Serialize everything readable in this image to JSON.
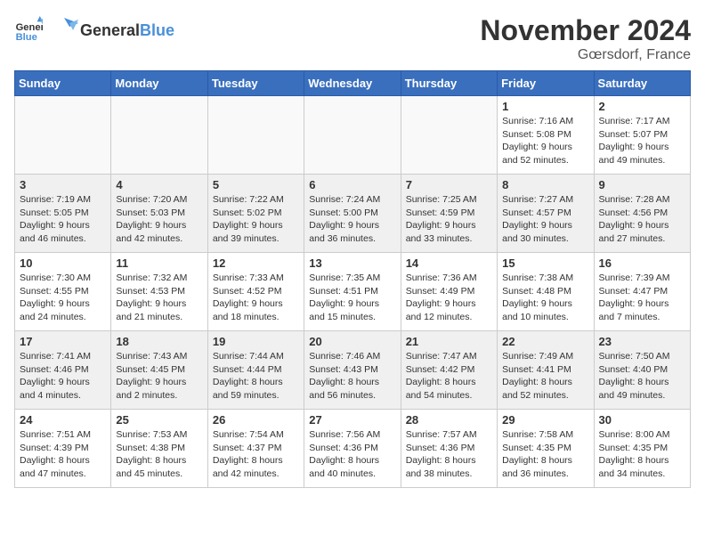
{
  "header": {
    "logo_general": "General",
    "logo_blue": "Blue",
    "month_year": "November 2024",
    "location": "Gœrsdorf, France"
  },
  "days_of_week": [
    "Sunday",
    "Monday",
    "Tuesday",
    "Wednesday",
    "Thursday",
    "Friday",
    "Saturday"
  ],
  "weeks": [
    {
      "shaded": false,
      "days": [
        {
          "date": "",
          "info": ""
        },
        {
          "date": "",
          "info": ""
        },
        {
          "date": "",
          "info": ""
        },
        {
          "date": "",
          "info": ""
        },
        {
          "date": "",
          "info": ""
        },
        {
          "date": "1",
          "info": "Sunrise: 7:16 AM\nSunset: 5:08 PM\nDaylight: 9 hours and 52 minutes."
        },
        {
          "date": "2",
          "info": "Sunrise: 7:17 AM\nSunset: 5:07 PM\nDaylight: 9 hours and 49 minutes."
        }
      ]
    },
    {
      "shaded": true,
      "days": [
        {
          "date": "3",
          "info": "Sunrise: 7:19 AM\nSunset: 5:05 PM\nDaylight: 9 hours and 46 minutes."
        },
        {
          "date": "4",
          "info": "Sunrise: 7:20 AM\nSunset: 5:03 PM\nDaylight: 9 hours and 42 minutes."
        },
        {
          "date": "5",
          "info": "Sunrise: 7:22 AM\nSunset: 5:02 PM\nDaylight: 9 hours and 39 minutes."
        },
        {
          "date": "6",
          "info": "Sunrise: 7:24 AM\nSunset: 5:00 PM\nDaylight: 9 hours and 36 minutes."
        },
        {
          "date": "7",
          "info": "Sunrise: 7:25 AM\nSunset: 4:59 PM\nDaylight: 9 hours and 33 minutes."
        },
        {
          "date": "8",
          "info": "Sunrise: 7:27 AM\nSunset: 4:57 PM\nDaylight: 9 hours and 30 minutes."
        },
        {
          "date": "9",
          "info": "Sunrise: 7:28 AM\nSunset: 4:56 PM\nDaylight: 9 hours and 27 minutes."
        }
      ]
    },
    {
      "shaded": false,
      "days": [
        {
          "date": "10",
          "info": "Sunrise: 7:30 AM\nSunset: 4:55 PM\nDaylight: 9 hours and 24 minutes."
        },
        {
          "date": "11",
          "info": "Sunrise: 7:32 AM\nSunset: 4:53 PM\nDaylight: 9 hours and 21 minutes."
        },
        {
          "date": "12",
          "info": "Sunrise: 7:33 AM\nSunset: 4:52 PM\nDaylight: 9 hours and 18 minutes."
        },
        {
          "date": "13",
          "info": "Sunrise: 7:35 AM\nSunset: 4:51 PM\nDaylight: 9 hours and 15 minutes."
        },
        {
          "date": "14",
          "info": "Sunrise: 7:36 AM\nSunset: 4:49 PM\nDaylight: 9 hours and 12 minutes."
        },
        {
          "date": "15",
          "info": "Sunrise: 7:38 AM\nSunset: 4:48 PM\nDaylight: 9 hours and 10 minutes."
        },
        {
          "date": "16",
          "info": "Sunrise: 7:39 AM\nSunset: 4:47 PM\nDaylight: 9 hours and 7 minutes."
        }
      ]
    },
    {
      "shaded": true,
      "days": [
        {
          "date": "17",
          "info": "Sunrise: 7:41 AM\nSunset: 4:46 PM\nDaylight: 9 hours and 4 minutes."
        },
        {
          "date": "18",
          "info": "Sunrise: 7:43 AM\nSunset: 4:45 PM\nDaylight: 9 hours and 2 minutes."
        },
        {
          "date": "19",
          "info": "Sunrise: 7:44 AM\nSunset: 4:44 PM\nDaylight: 8 hours and 59 minutes."
        },
        {
          "date": "20",
          "info": "Sunrise: 7:46 AM\nSunset: 4:43 PM\nDaylight: 8 hours and 56 minutes."
        },
        {
          "date": "21",
          "info": "Sunrise: 7:47 AM\nSunset: 4:42 PM\nDaylight: 8 hours and 54 minutes."
        },
        {
          "date": "22",
          "info": "Sunrise: 7:49 AM\nSunset: 4:41 PM\nDaylight: 8 hours and 52 minutes."
        },
        {
          "date": "23",
          "info": "Sunrise: 7:50 AM\nSunset: 4:40 PM\nDaylight: 8 hours and 49 minutes."
        }
      ]
    },
    {
      "shaded": false,
      "days": [
        {
          "date": "24",
          "info": "Sunrise: 7:51 AM\nSunset: 4:39 PM\nDaylight: 8 hours and 47 minutes."
        },
        {
          "date": "25",
          "info": "Sunrise: 7:53 AM\nSunset: 4:38 PM\nDaylight: 8 hours and 45 minutes."
        },
        {
          "date": "26",
          "info": "Sunrise: 7:54 AM\nSunset: 4:37 PM\nDaylight: 8 hours and 42 minutes."
        },
        {
          "date": "27",
          "info": "Sunrise: 7:56 AM\nSunset: 4:36 PM\nDaylight: 8 hours and 40 minutes."
        },
        {
          "date": "28",
          "info": "Sunrise: 7:57 AM\nSunset: 4:36 PM\nDaylight: 8 hours and 38 minutes."
        },
        {
          "date": "29",
          "info": "Sunrise: 7:58 AM\nSunset: 4:35 PM\nDaylight: 8 hours and 36 minutes."
        },
        {
          "date": "30",
          "info": "Sunrise: 8:00 AM\nSunset: 4:35 PM\nDaylight: 8 hours and 34 minutes."
        }
      ]
    }
  ]
}
